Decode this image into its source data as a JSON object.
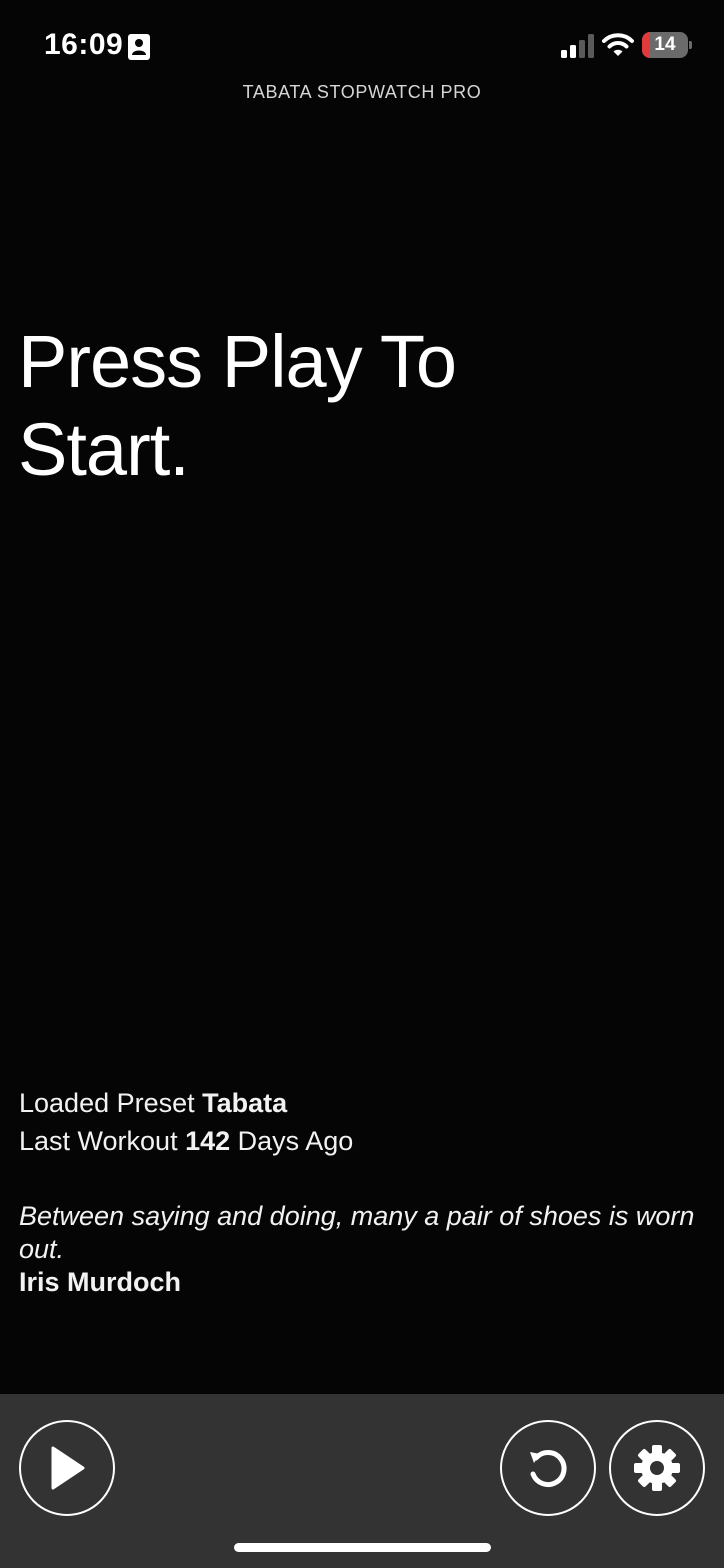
{
  "status_bar": {
    "time": "16:09",
    "battery_level": "14",
    "battery_fraction": 0.14,
    "contact_icon": "contact-card-icon",
    "signal_icon": "cellular-signal-icon",
    "wifi_icon": "wifi-icon"
  },
  "app": {
    "title": "TABATA STOPWATCH PRO"
  },
  "main": {
    "headline_line1": "Press Play To",
    "headline_line2": "Start.",
    "preset_label": "Loaded Preset",
    "preset_name": "Tabata",
    "last_workout_label": "Last Workout",
    "last_workout_days": "142",
    "last_workout_suffix": "Days Ago"
  },
  "quote": {
    "text": "Between saying and doing, many a pair of shoes is worn out.",
    "author": "Iris Murdoch"
  },
  "toolbar": {
    "play_icon": "play-icon",
    "reset_icon": "reset-icon",
    "settings_icon": "gear-icon"
  },
  "colors": {
    "background": "#050505",
    "toolbar": "#333333",
    "battery_low": "#e03a3a",
    "text": "#ffffff"
  }
}
